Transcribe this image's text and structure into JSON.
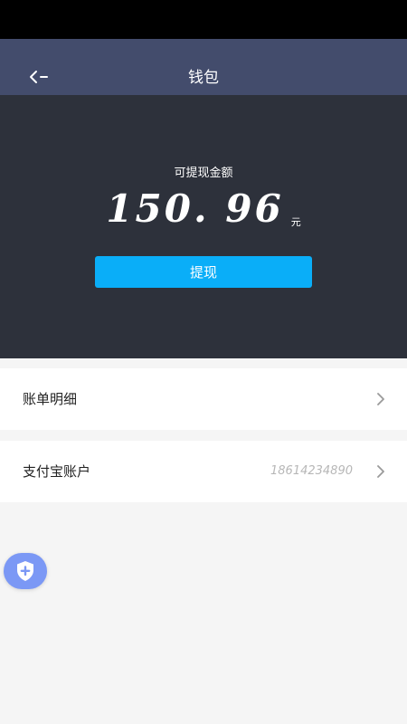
{
  "header": {
    "title": "钱包",
    "back_icon": "back-arrow-icon"
  },
  "balance": {
    "label": "可提现金额",
    "amount": "150. 96",
    "unit": "元",
    "withdraw_label": "提现",
    "withdraw_color": "#0aaef8"
  },
  "rows": [
    {
      "label": "账单明细",
      "value": ""
    },
    {
      "label": "支付宝账户",
      "value": "18614234890"
    }
  ],
  "floating": {
    "icon": "shield-plus-icon"
  },
  "colors": {
    "nav_bar": "#434c6c",
    "panel": "#2d313b",
    "background": "#f5f5f5"
  }
}
